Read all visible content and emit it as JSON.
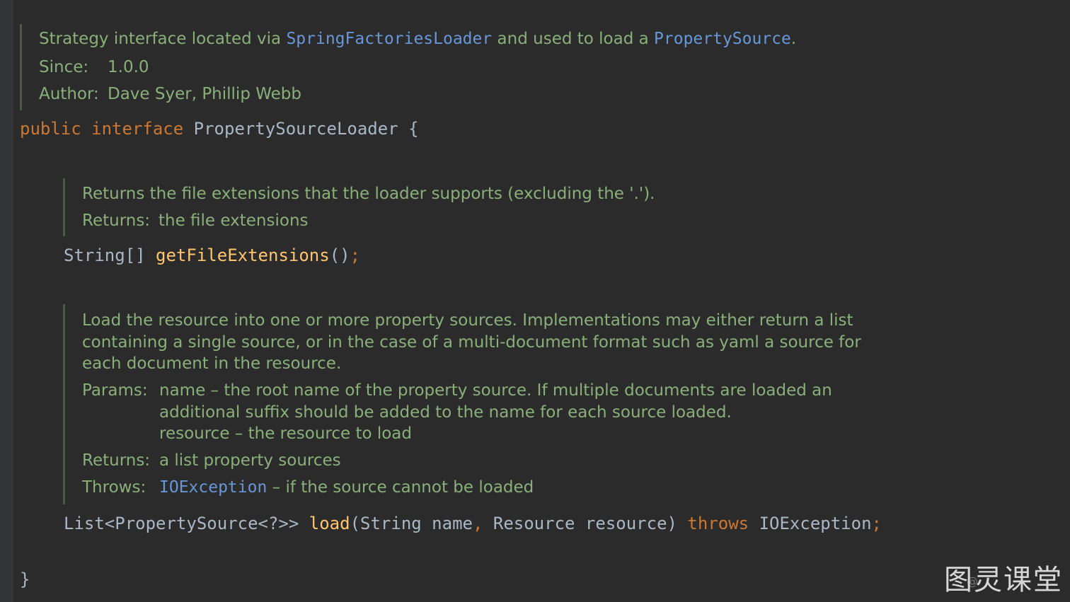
{
  "class_doc": {
    "line1_prefix": "Strategy interface located via ",
    "line1_link1": "SpringFactoriesLoader",
    "line1_mid": " and used to load a ",
    "line1_link2": "PropertySource",
    "line1_suffix": ".",
    "since_label": "Since:",
    "since_value": "1.0.0",
    "author_label": "Author:",
    "author_value": "Dave Syer, Phillip Webb"
  },
  "interface_decl": {
    "kw_public": "public",
    "kw_interface": "interface",
    "name": "PropertySourceLoader",
    "open_brace": "{"
  },
  "method1_doc": {
    "description": "Returns the file extensions that the loader supports (excluding the '.').",
    "returns_label": "Returns:",
    "returns_value": "the file extensions"
  },
  "method1_sig": {
    "return_type": "String[]",
    "name": "getFileExtensions",
    "parens": "()",
    "semicolon": ";"
  },
  "method2_doc": {
    "description_line1": "Load the resource into one or more property sources. Implementations may either return a list",
    "description_line2": "containing a single source, or in the case of a multi-document format such as yaml a source for",
    "description_line3": "each document in the resource.",
    "params_label": "Params:",
    "param1_line1": "name – the root name of the property source. If multiple documents are loaded an",
    "param1_line2": "additional suffix should be added to the name for each source loaded.",
    "param2": "resource – the resource to load",
    "returns_label": "Returns:",
    "returns_value": "a list property sources",
    "throws_label": "Throws:",
    "throws_link": "IOException",
    "throws_value": " – if the source cannot be loaded"
  },
  "method2_sig": {
    "return_type": "List<PropertySource<?>> ",
    "name": "load",
    "open_paren": "(",
    "param1": "String name",
    "comma": ",",
    "param2": " Resource resource) ",
    "kw_throws": "throws",
    "exception": " IOException",
    "semicolon": ";"
  },
  "close_brace": "}",
  "watermark": {
    "text": "图灵课堂",
    "small_text": "@"
  }
}
